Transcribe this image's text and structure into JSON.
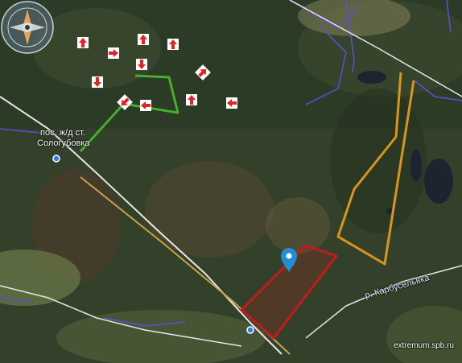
{
  "map": {
    "settlement_line_1": "пос. ж/д ст.",
    "settlement_line_2": "Сологубовка",
    "river_label": "р. Карбусельвка",
    "credit": "extremum.spb.ru"
  },
  "colors": {
    "green_route": "#43b02a",
    "orange_boundary": "#d9951e",
    "red_area": "#c51a1a",
    "railway": "#c8a24a",
    "road": "#e6e6e6",
    "paths": "#5b4fd6",
    "arrows": "#e32222",
    "marker": "#1f8fd6"
  },
  "icons": {
    "arrow": "direction-arrow-icon",
    "marker": "map-pin-icon",
    "station": "station-dot-icon",
    "logo": "compass-logo-icon"
  }
}
